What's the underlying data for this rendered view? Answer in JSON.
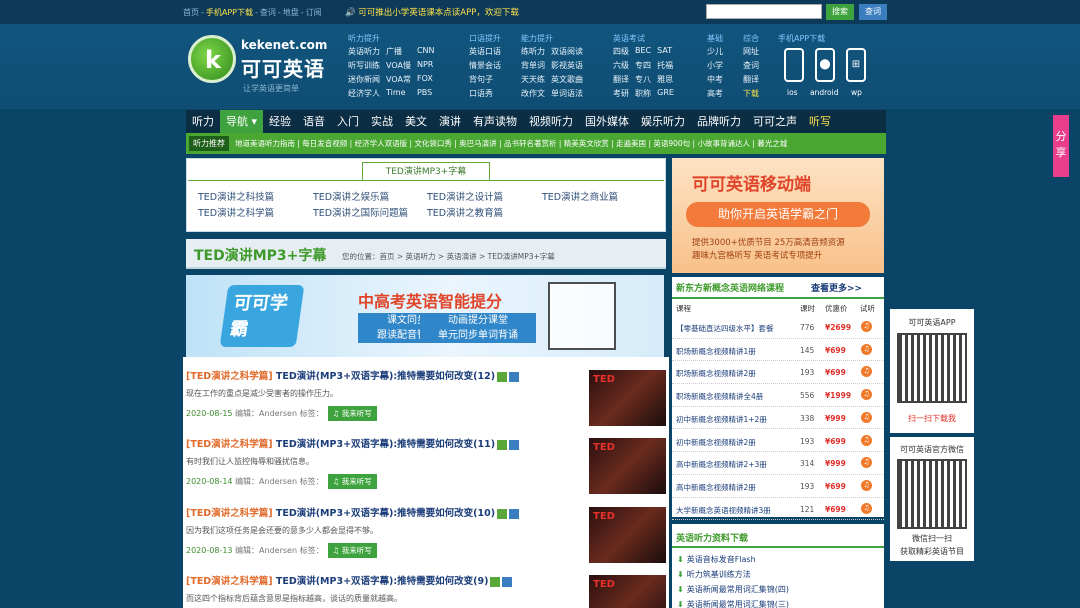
{
  "topbar": {
    "links": [
      "首页",
      "-",
      "手机APP下载",
      "-",
      "查词",
      "-",
      "地盘",
      "-",
      "订阅"
    ],
    "notice": "可可推出小学英语课本点读APP，欢迎下载",
    "search_placeholder": "",
    "search_btn": "搜索",
    "query_btn": "查词"
  },
  "logo": {
    "domain": "kekenet.com",
    "name": "可可英语",
    "slogan": "让学英语更简单",
    "icon_letter": "k"
  },
  "categories": [
    {
      "title": "听力提升",
      "items": [
        "英语听力",
        "听写训练",
        "迷你新闻",
        "经济学人",
        "广播",
        "VOA慢",
        "VOA常",
        "Time",
        "CNN",
        "NPR",
        "FOX",
        "PBS"
      ]
    },
    {
      "title": "口语提升",
      "items": [
        "英语口语",
        "情景会话",
        "背句子",
        "口语秀"
      ]
    },
    {
      "title": "能力提升",
      "items": [
        "练听力",
        "背单词",
        "天天练",
        "改作文",
        "双语阅读",
        "影视英语",
        "英文歌曲",
        "单词语法"
      ]
    },
    {
      "title": "英语考试",
      "items": [
        "四级",
        "六级",
        "翻译",
        "考研",
        "BEC",
        "专四",
        "专八",
        "职称",
        "SAT",
        "托福",
        "雅思",
        "GRE"
      ]
    },
    {
      "title": "基础",
      "items": [
        "少儿",
        "小学",
        "中考",
        "高考"
      ]
    },
    {
      "title": "综合",
      "items": [
        "网址",
        "查词",
        "翻译",
        "下载"
      ]
    },
    {
      "title": "手机APP下载",
      "apps": [
        "ios",
        "android",
        "wp"
      ]
    }
  ],
  "nav": [
    "听力",
    "导航 ▾",
    "经验",
    "语音",
    "入门",
    "实战",
    "美文",
    "演讲",
    "有声读物",
    "视频听力",
    "国外媒体",
    "娱乐听力",
    "品牌听力",
    "可可之声",
    "听写"
  ],
  "subnav": {
    "tag": "听力推荐",
    "items": "地道美语听力指南 | 每日发音视频 | 经济学人双语版 | 文化袋口秀 | 奥巴马演讲 | 品书轩名著赏析 | 精美英文欣赏 | 走遍美国 | 英语900句 | 小故事背诵达人 | 暮光之城"
  },
  "tabs": {
    "title": "TED演讲MP3+字幕",
    "links": [
      "TED演讲之科技篇",
      "TED演讲之娱乐篇",
      "TED演讲之设计篇",
      "TED演讲之商业篇",
      "TED演讲之科学篇",
      "TED演讲之国际问题篇",
      "TED演讲之教育篇"
    ]
  },
  "titlebar": {
    "title": "TED演讲MP3+字幕",
    "location": "您的位置：首页 > 英语听力 > 英语演讲 > TED演讲MP3+字幕"
  },
  "banner": {
    "logo": "可可学霸",
    "headline": "中高考英语智能提分",
    "box1": "课文同步收听\n跟读配音智能打分",
    "box2": "动画提分课堂\n单元同步单词背诵"
  },
  "articles": [
    {
      "category": "[TED演讲之科学篇]",
      "title": "TED演讲(MP3+双语字幕):推特需要如何改变(12)",
      "desc": "现在工作的重点是减少受害者的操作压力。",
      "date": "2020-08-15",
      "editor": "编辑：Andersen 标签：",
      "btn": "我来听写",
      "thumb": "TED"
    },
    {
      "category": "[TED演讲之科学篇]",
      "title": "TED演讲(MP3+双语字幕):推特需要如何改变(11)",
      "desc": "有时我们让人监控侮辱和骚扰信息。",
      "date": "2020-08-14",
      "editor": "编辑：Andersen 标签：",
      "btn": "我来听写",
      "thumb": "TED"
    },
    {
      "category": "[TED演讲之科学篇]",
      "title": "TED演讲(MP3+双语字幕):推特需要如何改变(10)",
      "desc": "因为我们这项任务是会还要的意多少人都会显得不够。",
      "date": "2020-08-13",
      "editor": "编辑：Andersen 标签：",
      "btn": "我来听写",
      "thumb": "TED"
    },
    {
      "category": "[TED演讲之科学篇]",
      "title": "TED演讲(MP3+双语字幕):推特需要如何改变(9)",
      "desc": "而这四个指标背后蕴含意思是指标越高，谈话的质量就越高。",
      "date": "",
      "editor": "",
      "btn": "",
      "thumb": "TED"
    }
  ],
  "ad": {
    "headline": "可可英语移动端",
    "sub": "助你开启英语学霸之门",
    "line1": "提供3000+优质节目 25万高清音频资源",
    "line2": "趣味九宫格听写 英语考试专项提升"
  },
  "courses": {
    "header": "新东方新概念英语网络课程",
    "more": "查看更多>>",
    "cols": [
      "课程",
      "课时",
      "优惠价",
      "试听"
    ],
    "rows": [
      {
        "name": "【零基础直达四级水平】套餐",
        "hours": "776",
        "price": "¥2699"
      },
      {
        "name": "职场新概念视频精讲1册",
        "hours": "145",
        "price": "¥699"
      },
      {
        "name": "职场新概念视频精讲2册",
        "hours": "193",
        "price": "¥699"
      },
      {
        "name": "职场新概念视频精讲全4册",
        "hours": "556",
        "price": "¥1999"
      },
      {
        "name": "初中新概念视频精讲1+2册",
        "hours": "338",
        "price": "¥999"
      },
      {
        "name": "初中新概念视频精讲2册",
        "hours": "193",
        "price": "¥699"
      },
      {
        "name": "高中新概念视频精讲2+3册",
        "hours": "314",
        "price": "¥999"
      },
      {
        "name": "高中新概念视频精讲2册",
        "hours": "193",
        "price": "¥699"
      },
      {
        "name": "大学新概念英语视频精讲3册",
        "hours": "121",
        "price": "¥699"
      }
    ]
  },
  "downloads": {
    "header": "英语听力资料下载",
    "items": [
      "英语音标发音Flash",
      "听力筑基训练方法",
      "英语新闻最常用词汇集锦(四)",
      "英语新闻最常用词汇集锦(三)"
    ]
  },
  "side": {
    "app_title": "可可英语APP",
    "app_link": "扫一扫下载我",
    "wx_title": "可可英语官方微信",
    "wx_l1": "微信扫一扫",
    "wx_l2": "获取精彩英语节目"
  },
  "share": "分享"
}
